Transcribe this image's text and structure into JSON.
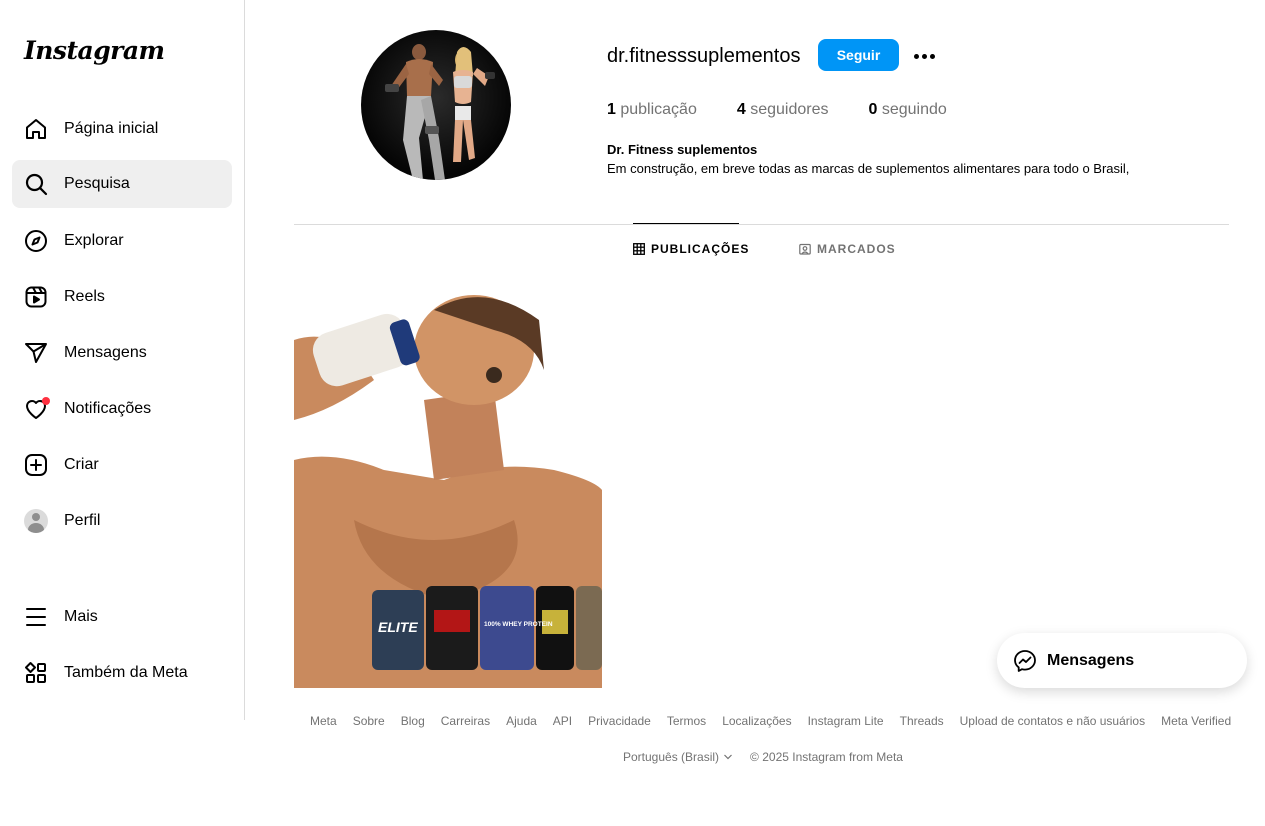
{
  "app": {
    "logo_text": "Instagram"
  },
  "sidebar": {
    "items": [
      {
        "label": "Página inicial",
        "icon": "home-icon"
      },
      {
        "label": "Pesquisa",
        "icon": "search-icon"
      },
      {
        "label": "Explorar",
        "icon": "compass-icon"
      },
      {
        "label": "Reels",
        "icon": "reels-icon"
      },
      {
        "label": "Mensagens",
        "icon": "send-icon"
      },
      {
        "label": "Notificações",
        "icon": "heart-icon"
      },
      {
        "label": "Criar",
        "icon": "plus-square-icon"
      },
      {
        "label": "Perfil",
        "icon": "avatar"
      },
      {
        "label": "Mais",
        "icon": "menu-icon"
      },
      {
        "label": "Também da Meta",
        "icon": "meta-apps-icon"
      }
    ],
    "active": "Pesquisa",
    "notification_badge": true
  },
  "profile": {
    "username": "dr.fitnesssuplementos",
    "follow_label": "Seguir",
    "stats": {
      "posts_count": "1",
      "posts_label": " publicação",
      "followers_count": "4",
      "followers_label": " seguidores",
      "following_count": "0",
      "following_label": " seguindo"
    },
    "full_name": "Dr. Fitness suplementos",
    "bio": "Em construção, em breve todas as marcas de suplementos alimentares para todo o Brasil,"
  },
  "tabs": {
    "posts": "PUBLICAÇÕES",
    "tagged": "MARCADOS",
    "active": "PUBLICAÇÕES"
  },
  "post": {
    "product_labels": [
      "ELITE",
      "100% WHEY PROTEIN"
    ]
  },
  "footer": {
    "links": [
      "Meta",
      "Sobre",
      "Blog",
      "Carreiras",
      "Ajuda",
      "API",
      "Privacidade",
      "Termos",
      "Localizações",
      "Instagram Lite",
      "Threads",
      "Upload de contatos e não usuários",
      "Meta Verified"
    ],
    "language": "Português (Brasil)",
    "copyright": "© 2025 Instagram from Meta"
  },
  "messages_float": {
    "label": "Mensagens"
  },
  "colors": {
    "accent": "#0095f6",
    "badge": "#ff3040",
    "muted": "#737373",
    "divider": "#dbdbdb"
  }
}
